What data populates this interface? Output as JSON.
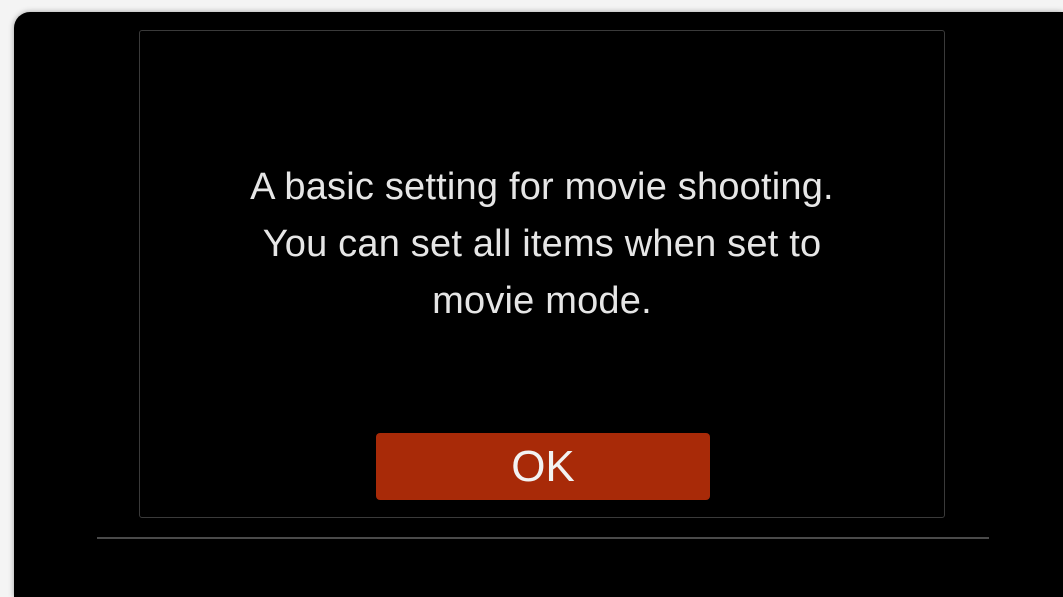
{
  "dialog": {
    "message_lines": [
      "A basic setting for movie shooting.",
      "You can set all items when set to",
      "movie mode."
    ],
    "ok_label": "OK"
  },
  "colors": {
    "background": "#000000",
    "button": "#a82a08",
    "text": "#e6e6e6",
    "border": "#3a3a3a"
  }
}
